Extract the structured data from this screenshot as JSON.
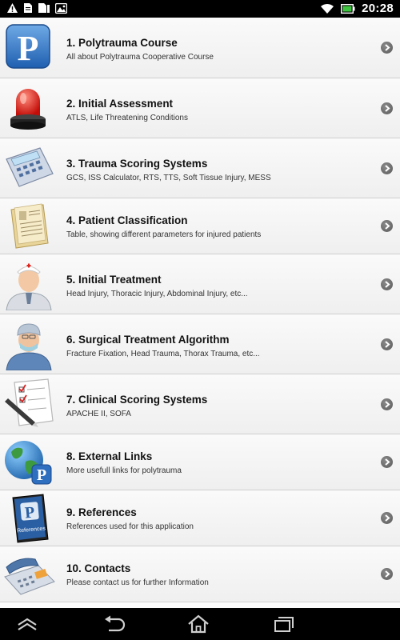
{
  "status_bar": {
    "time": "20:28",
    "left_icons": [
      "warning-icon",
      "sd-card-icon",
      "sim-card-icon",
      "image-icon"
    ],
    "right_icons": [
      "wifi-icon",
      "battery-icon"
    ]
  },
  "menu": {
    "items": [
      {
        "title": "1. Polytrauma Course",
        "subtitle": "All about Polytrauma Cooperative Course",
        "icon": "polytrauma-logo-icon"
      },
      {
        "title": "2. Initial Assessment",
        "subtitle": "ATLS, Life Threatening Conditions",
        "icon": "siren-icon"
      },
      {
        "title": "3. Trauma Scoring Systems",
        "subtitle": "GCS, ISS Calculator, RTS, TTS, Soft Tissue Injury, MESS",
        "icon": "calculator-icon"
      },
      {
        "title": "4. Patient Classification",
        "subtitle": "Table, showing different parameters for injured patients",
        "icon": "document-folder-icon"
      },
      {
        "title": "5. Initial Treatment",
        "subtitle": "Head Injury, Thoracic Injury, Abdominal Injury, etc...",
        "icon": "nurse-icon"
      },
      {
        "title": "6. Surgical Treatment Algorithm",
        "subtitle": "Fracture Fixation, Head Trauma, Thorax Trauma, etc...",
        "icon": "surgeon-icon"
      },
      {
        "title": "7. Clinical Scoring Systems",
        "subtitle": "APACHE II, SOFA",
        "icon": "checklist-icon"
      },
      {
        "title": "8. External Links",
        "subtitle": "More usefull links for polytrauma",
        "icon": "globe-icon"
      },
      {
        "title": "9. References",
        "subtitle": "References used for this application",
        "icon": "references-book-icon"
      },
      {
        "title": "10. Contacts",
        "subtitle": "Please contact us for further Information",
        "icon": "telephone-icon"
      }
    ],
    "logo_letter": "P",
    "book_label": "References"
  },
  "nav_bar": {
    "icons": [
      "up-icon",
      "back-icon",
      "home-icon",
      "recent-apps-icon"
    ]
  }
}
